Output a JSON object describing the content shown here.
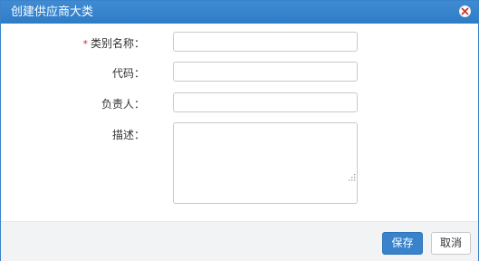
{
  "dialog": {
    "title": "创建供应商大类",
    "close_icon": "close-icon"
  },
  "form": {
    "category_name": {
      "label": "类别名称：",
      "required_mark": "*",
      "value": ""
    },
    "code": {
      "label": "代码：",
      "value": ""
    },
    "owner": {
      "label": "负责人：",
      "value": ""
    },
    "description": {
      "label": "描述：",
      "value": ""
    }
  },
  "footer": {
    "save_label": "保存",
    "cancel_label": "取消"
  },
  "colors": {
    "titlebar": "#2f7cc6",
    "primary_button": "#3883cc",
    "required": "#d8281e"
  }
}
